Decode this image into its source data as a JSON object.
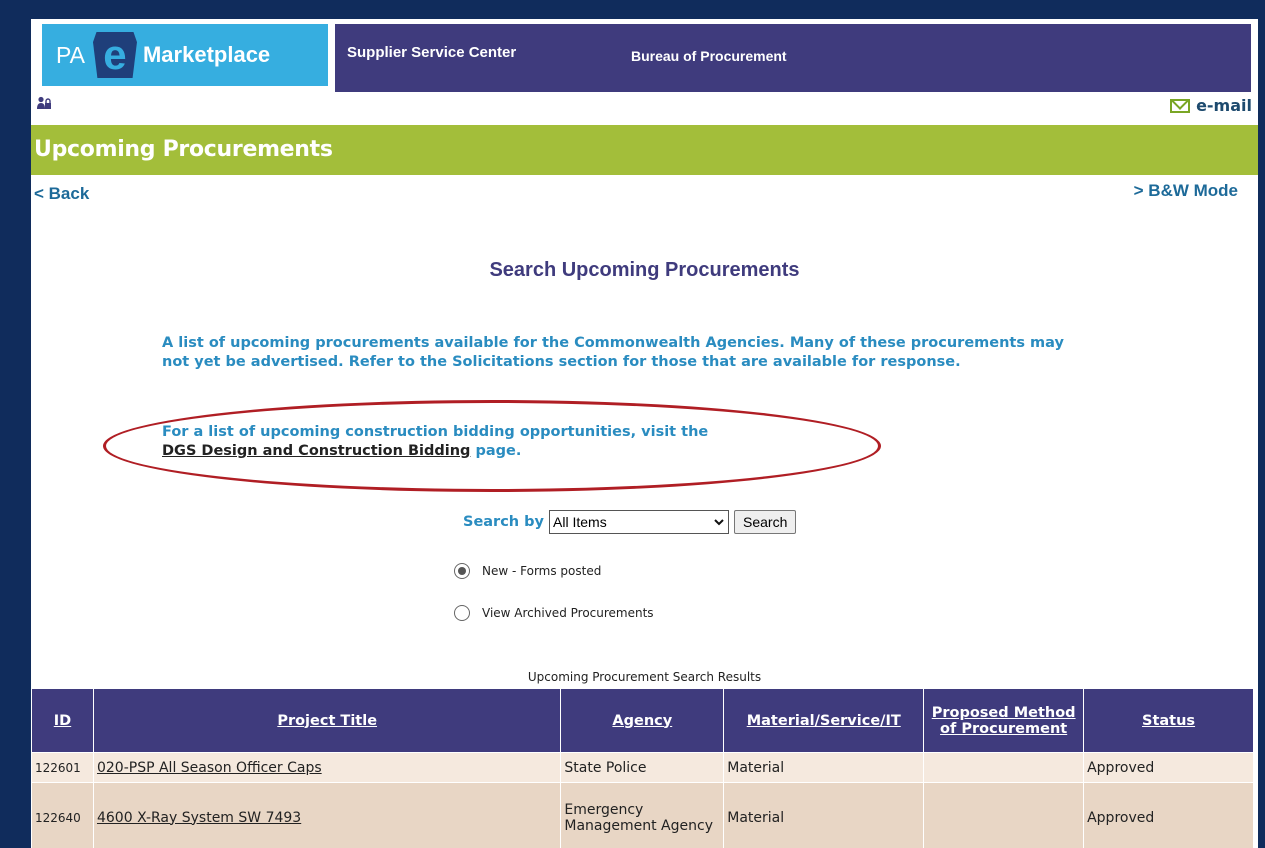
{
  "header": {
    "logo_pa": "PA",
    "logo_e": "e",
    "logo_marketplace": "Marketplace",
    "nav": [
      {
        "label": "Supplier Service Center"
      },
      {
        "label": "Bureau of Procurement"
      }
    ],
    "email_label": "e-mail"
  },
  "page_title": "Upcoming Procurements",
  "back_label": "< Back",
  "bw_label": "> B&W Mode",
  "heading": "Search Upcoming Procurements",
  "intro": "A list of upcoming procurements available for the Commonwealth Agencies. Many of these procurements may not yet be advertised. Refer to the Solicitations section for those that are available for response.",
  "construction": {
    "prefix": "For a list of upcoming construction bidding opportunities, visit the",
    "link": "DGS Design and Construction Bidding",
    "suffix": " page."
  },
  "search": {
    "label": "Search by",
    "selected": "All Items",
    "button": "Search"
  },
  "radios": [
    {
      "label": "New - Forms posted",
      "checked": true
    },
    {
      "label": "View Archived Procurements",
      "checked": false
    }
  ],
  "results": {
    "caption": "Upcoming Procurement Search Results",
    "columns": [
      "ID",
      "Project Title",
      "Agency",
      "Material/Service/IT",
      "Proposed Method of Procurement",
      "Status"
    ],
    "rows": [
      {
        "id": "122601",
        "title": "020-PSP All Season Officer Caps",
        "agency": "State Police",
        "type": "Material",
        "method": "",
        "status": "Approved"
      },
      {
        "id": "122640",
        "title": "4600 X-Ray System SW 7493",
        "agency": "Emergency Management Agency",
        "type": "Material",
        "method": "",
        "status": "Approved"
      }
    ]
  },
  "colors": {
    "navbar": "#3f3b7d",
    "logo": "#36aee0",
    "greenbar": "#a3be3a",
    "link_blue": "#2a8cc0",
    "annotation_red": "#b01e24"
  }
}
